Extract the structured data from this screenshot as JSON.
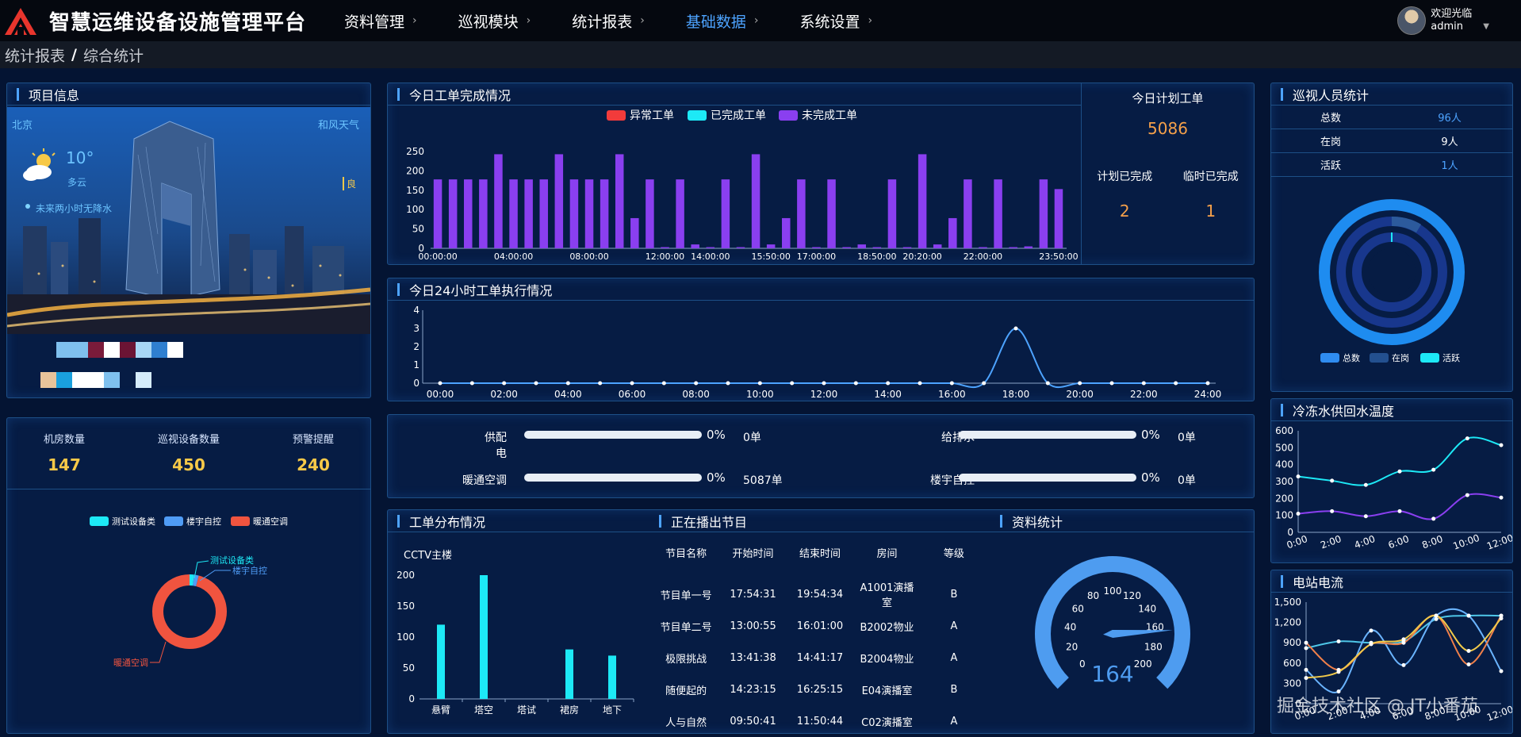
{
  "header": {
    "app_title": "智慧运维设备设施管理平台",
    "nav": [
      {
        "label": "资料管理",
        "active": false
      },
      {
        "label": "巡视模块",
        "active": false
      },
      {
        "label": "统计报表",
        "active": false
      },
      {
        "label": "基础数据",
        "active": true
      },
      {
        "label": "系统设置",
        "active": false
      }
    ],
    "user_greeting": "欢迎光临",
    "user_name": "admin"
  },
  "breadcrumb": [
    "统计报表",
    "综合统计"
  ],
  "project_info": {
    "title": "项目信息",
    "city": "北京",
    "weather_source": "和风天气",
    "temperature": "10°",
    "condition": "多云",
    "aqi": "良",
    "forecast": "未来两小时无降水"
  },
  "counts": {
    "items": [
      {
        "label": "机房数量",
        "value": "147"
      },
      {
        "label": "巡视设备数量",
        "value": "450"
      },
      {
        "label": "预警提醒",
        "value": "240"
      }
    ]
  },
  "device_donut": {
    "legend": [
      "测试设备类",
      "楼宇自控",
      "暖通空调"
    ],
    "labels": [
      "测试设备类",
      "楼宇自控",
      "暖通空调"
    ],
    "colors": [
      "#1de9f6",
      "#4f9cf6",
      "#f0543f"
    ],
    "values": [
      2,
      2,
      96
    ]
  },
  "work_today": {
    "title": "今日工单完成情况",
    "legend": [
      "异常工单",
      "已完成工单",
      "未完成工单"
    ],
    "legend_colors": [
      "#f23b3b",
      "#1de9f6",
      "#8a3ff0"
    ],
    "plan_title": "今日计划工单",
    "plan_value": "5086",
    "done_label": "计划已完成",
    "done_value": "2",
    "temp_label": "临时已完成",
    "temp_value": "1"
  },
  "exec24": {
    "title": "今日24小时工单执行情况"
  },
  "progress": {
    "items": [
      {
        "label": "供配电",
        "pct": "0%",
        "count": "0单"
      },
      {
        "label": "给排水",
        "pct": "0%",
        "count": "0单"
      },
      {
        "label": "暖通空调",
        "pct": "0%",
        "count": "5087单"
      },
      {
        "label": "楼宇自控",
        "pct": "0%",
        "count": "0单"
      }
    ]
  },
  "distribution": {
    "title": "工单分布情况",
    "subtitle": "CCTV主楼"
  },
  "programs": {
    "title": "正在播出节目",
    "headers": [
      "节目名称",
      "开始时间",
      "结束时间",
      "房间",
      "等级"
    ],
    "rows": [
      [
        "节目单一号",
        "17:54:31",
        "19:54:34",
        "A1001演播室",
        "B"
      ],
      [
        "节目单二号",
        "13:00:55",
        "16:01:00",
        "B2002物业",
        "A"
      ],
      [
        "极限挑战",
        "13:41:38",
        "14:41:17",
        "B2004物业",
        "A"
      ],
      [
        "随便起的",
        "14:23:15",
        "16:25:15",
        "E04演播室",
        "B"
      ],
      [
        "人与自然",
        "09:50:41",
        "11:50:44",
        "C02演播室",
        "A"
      ]
    ]
  },
  "docstats": {
    "title": "资料统计",
    "gauge_value": "164"
  },
  "patrol": {
    "title": "巡视人员统计",
    "rows": [
      {
        "label": "总数",
        "value": "96人",
        "color": "#4da3ff"
      },
      {
        "label": "在岗",
        "value": "9人",
        "color": "#ffffff"
      },
      {
        "label": "活跃",
        "value": "1人",
        "color": "#4da3ff"
      }
    ],
    "legend": [
      "总数",
      "在岗",
      "活跃"
    ],
    "legend_colors": [
      "#2f8cf0",
      "#23508f",
      "#1de9f6"
    ]
  },
  "cold_water": {
    "title": "冷冻水供回水温度"
  },
  "station_current": {
    "title": "电站电流"
  },
  "watermark": "掘金技术社区 @ JT小番茄",
  "chart_data": [
    {
      "type": "bar",
      "title": "今日工单完成情况",
      "categories": [
        "00:00:00",
        "00:50:00",
        "01:40:00",
        "02:30:00",
        "03:20:00",
        "04:00:00",
        "04:50:00",
        "05:40:00",
        "06:30:00",
        "07:20:00",
        "08:00:00",
        "08:50:00",
        "09:40:00",
        "10:30:00",
        "11:20:00",
        "12:00:00",
        "12:50:00",
        "13:30:00",
        "14:00:00",
        "14:30:00",
        "15:00:00",
        "15:20:00",
        "15:50:00",
        "16:20:00",
        "16:50:00",
        "17:00:00",
        "17:30:00",
        "18:00:00",
        "18:20:00",
        "18:50:00",
        "19:20:00",
        "19:50:00",
        "20:20:00",
        "20:50:00",
        "21:20:00",
        "21:50:00",
        "22:00:00",
        "22:30:00",
        "23:00:00",
        "23:20:00",
        "23:35:00",
        "23:50:00"
      ],
      "tick_labels": [
        "00:00:00",
        "04:00:00",
        "08:00:00",
        "12:00:00",
        "14:00:00",
        "15:50:00",
        "17:00:00",
        "18:50:00",
        "20:20:00",
        "22:00:00",
        "23:50:00"
      ],
      "series": [
        {
          "name": "异常工单",
          "values": [
            0,
            0,
            0,
            0,
            0,
            0,
            0,
            0,
            0,
            0,
            0,
            0,
            0,
            0,
            0,
            0,
            0,
            0,
            0,
            0,
            0,
            0,
            0,
            0,
            0,
            0,
            0,
            0,
            0,
            0,
            0,
            0,
            0,
            0,
            0,
            0,
            0,
            0,
            0,
            0,
            0,
            0
          ]
        },
        {
          "name": "已完成工单",
          "values": [
            0,
            0,
            0,
            0,
            0,
            0,
            0,
            0,
            0,
            0,
            0,
            0,
            0,
            0,
            0,
            0,
            0,
            0,
            0,
            0,
            0,
            0,
            0,
            0,
            0,
            0,
            0,
            0,
            0,
            0,
            0,
            0,
            0,
            0,
            0,
            0,
            0,
            0,
            0,
            0,
            0,
            0
          ]
        },
        {
          "name": "未完成工单",
          "values": [
            178,
            178,
            178,
            178,
            243,
            178,
            178,
            178,
            243,
            178,
            178,
            178,
            243,
            78,
            178,
            3,
            178,
            10,
            3,
            178,
            3,
            243,
            10,
            78,
            178,
            3,
            178,
            3,
            10,
            3,
            178,
            3,
            243,
            10,
            78,
            178,
            3,
            178,
            3,
            5,
            178,
            153
          ]
        }
      ],
      "ylim": [
        0,
        250
      ],
      "yticks": [
        0,
        50,
        100,
        150,
        200,
        250
      ]
    },
    {
      "type": "line",
      "title": "今日24小时工单执行情况",
      "x": [
        "00:00",
        "01:00",
        "02:00",
        "03:00",
        "04:00",
        "05:00",
        "06:00",
        "07:00",
        "08:00",
        "09:00",
        "10:00",
        "11:00",
        "12:00",
        "13:00",
        "14:00",
        "15:00",
        "16:00",
        "17:00",
        "18:00",
        "19:00",
        "20:00",
        "21:00",
        "22:00",
        "23:00",
        "24:00"
      ],
      "tick_labels": [
        "00:00",
        "02:00",
        "04:00",
        "06:00",
        "08:00",
        "10:00",
        "12:00",
        "14:00",
        "16:00",
        "18:00",
        "20:00",
        "22:00",
        "24:00"
      ],
      "values": [
        0,
        0,
        0,
        0,
        0,
        0,
        0,
        0,
        0,
        0,
        0,
        0,
        0,
        0,
        0,
        0,
        0,
        0,
        3,
        0,
        0,
        0,
        0,
        0,
        0
      ],
      "ylim": [
        0,
        4
      ],
      "yticks": [
        0,
        1,
        2,
        3,
        4
      ]
    },
    {
      "type": "bar",
      "title": "工单分布情况",
      "categories": [
        "悬臂",
        "塔空",
        "塔试",
        "裙房",
        "地下"
      ],
      "values": [
        120,
        200,
        0,
        80,
        70
      ],
      "ylim": [
        0,
        200
      ],
      "yticks": [
        0,
        50,
        100,
        150,
        200
      ]
    },
    {
      "type": "line",
      "title": "冷冻水供回水温度",
      "x": [
        "0:00",
        "2:00",
        "4:00",
        "6:00",
        "8:00",
        "10:00",
        "12:00"
      ],
      "series": [
        {
          "values": [
            330,
            305,
            280,
            360,
            370,
            555,
            515
          ]
        },
        {
          "values": [
            110,
            125,
            95,
            125,
            80,
            220,
            205
          ]
        }
      ],
      "colors": [
        "#1de9f6",
        "#8a3ff0"
      ],
      "ylim": [
        0,
        600
      ],
      "yticks": [
        0,
        100,
        200,
        300,
        400,
        500,
        600
      ]
    },
    {
      "type": "line",
      "title": "电站电流",
      "x": [
        "0:00",
        "2:00",
        "4:00",
        "6:00",
        "8:00",
        "10:00",
        "12:00"
      ],
      "series": [
        {
          "values": [
            820,
            920,
            900,
            920,
            1250,
            1300,
            1300
          ]
        },
        {
          "values": [
            500,
            180,
            1080,
            570,
            1300,
            1300,
            480
          ]
        },
        {
          "values": [
            900,
            500,
            880,
            900,
            1300,
            580,
            1300
          ]
        },
        {
          "values": [
            380,
            470,
            880,
            950,
            1300,
            780,
            1260
          ]
        }
      ],
      "colors": [
        "#4ec6e8",
        "#6ab4ff",
        "#f0804a",
        "#f0c94a"
      ],
      "ylim": [
        0,
        1500
      ],
      "yticks": [
        0,
        300,
        600,
        900,
        1200,
        1500
      ],
      "ytick_labels": [
        "0",
        "300",
        "600",
        "900",
        "1,200",
        "1,500"
      ]
    }
  ]
}
